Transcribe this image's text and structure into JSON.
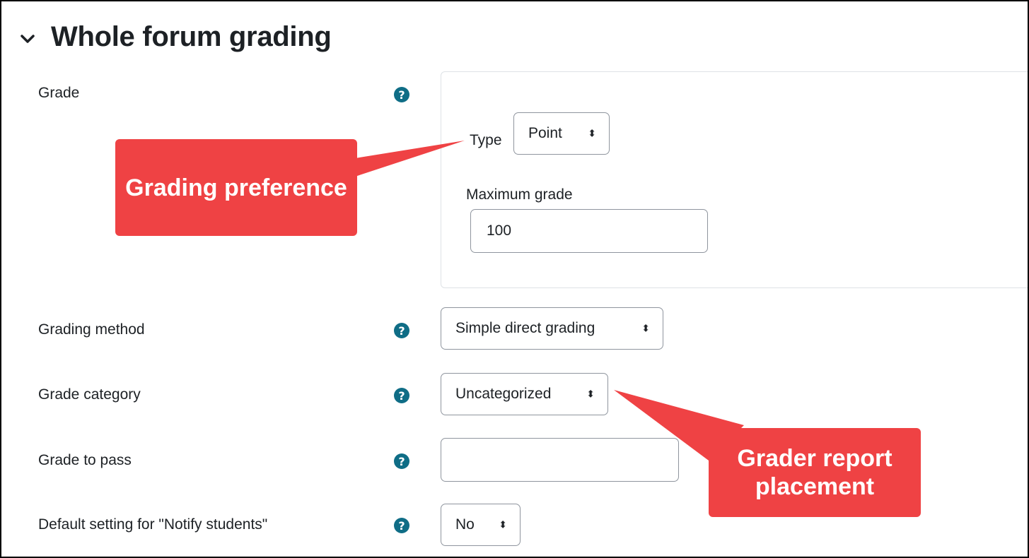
{
  "section": {
    "title": "Whole forum grading",
    "toggle_icon": "chevron-down-icon"
  },
  "fields": {
    "grade": {
      "label": "Grade",
      "type_label": "Type",
      "type_value": "Point",
      "max_label": "Maximum grade",
      "max_value": "100"
    },
    "grading_method": {
      "label": "Grading method",
      "value": "Simple direct grading"
    },
    "grade_category": {
      "label": "Grade category",
      "value": "Uncategorized"
    },
    "grade_to_pass": {
      "label": "Grade to pass",
      "value": ""
    },
    "notify_students": {
      "label": "Default setting for \"Notify students\"",
      "value": "No"
    }
  },
  "help_icon": "?",
  "select_arrows": "⬍",
  "callouts": {
    "grading_preference": "Grading preference",
    "grader_report": "Grader report placement"
  },
  "colors": {
    "callout": "#ef4244",
    "help_icon": "#0f6d86",
    "border": "#8f959e"
  }
}
